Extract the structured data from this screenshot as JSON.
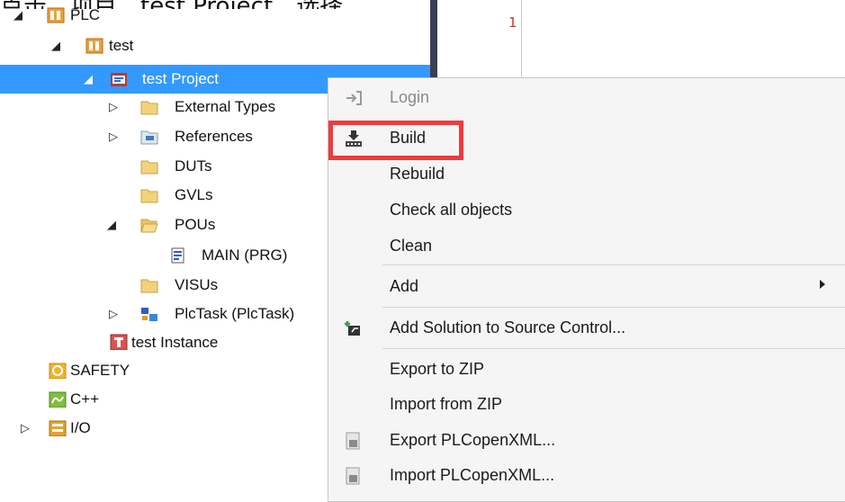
{
  "caption": {
    "text": "点击…项目…test Project…选择"
  },
  "tree": {
    "items": [
      {
        "id": "plc",
        "label": "PLC",
        "expanded": true
      },
      {
        "id": "test",
        "label": "test",
        "expanded": true
      },
      {
        "id": "test-project",
        "label": "test Project",
        "expanded": true,
        "selected": true
      },
      {
        "id": "external-types",
        "label": "External Types",
        "expanded": false
      },
      {
        "id": "references",
        "label": "References",
        "expanded": false
      },
      {
        "id": "duts",
        "label": "DUTs"
      },
      {
        "id": "gvls",
        "label": "GVLs"
      },
      {
        "id": "pous",
        "label": "POUs",
        "expanded": true
      },
      {
        "id": "main-prg",
        "label": "MAIN (PRG)"
      },
      {
        "id": "visus",
        "label": "VISUs"
      },
      {
        "id": "plctask",
        "label": "PlcTask (PlcTask)",
        "expanded": false
      },
      {
        "id": "test-instance",
        "label": "test Instance"
      },
      {
        "id": "safety",
        "label": "SAFETY"
      },
      {
        "id": "cpp",
        "label": "C++"
      },
      {
        "id": "io",
        "label": "I/O",
        "expanded": false
      }
    ]
  },
  "editor": {
    "line_number": "1"
  },
  "context_menu": {
    "items": [
      {
        "id": "login",
        "label": "Login",
        "disabled": true,
        "icon": "login-icon"
      },
      {
        "id": "build",
        "label": "Build",
        "icon": "build-icon",
        "highlighted": true
      },
      {
        "id": "rebuild",
        "label": "Rebuild"
      },
      {
        "id": "check-all",
        "label": "Check all objects"
      },
      {
        "id": "clean",
        "label": "Clean"
      },
      {
        "id": "add",
        "label": "Add",
        "submenu": true
      },
      {
        "id": "add-solution",
        "label": "Add Solution to Source Control...",
        "icon": "source-control-icon"
      },
      {
        "id": "export-zip",
        "label": "Export to ZIP"
      },
      {
        "id": "import-zip",
        "label": "Import from ZIP"
      },
      {
        "id": "export-xml",
        "label": "Export PLCopenXML...",
        "icon": "xml-export-icon"
      },
      {
        "id": "import-xml",
        "label": "Import PLCopenXML...",
        "icon": "xml-import-icon"
      }
    ]
  },
  "colors": {
    "selection": "#3399ff",
    "highlight_border": "#ef3b3b",
    "menu_bg": "#f5f5f5"
  }
}
